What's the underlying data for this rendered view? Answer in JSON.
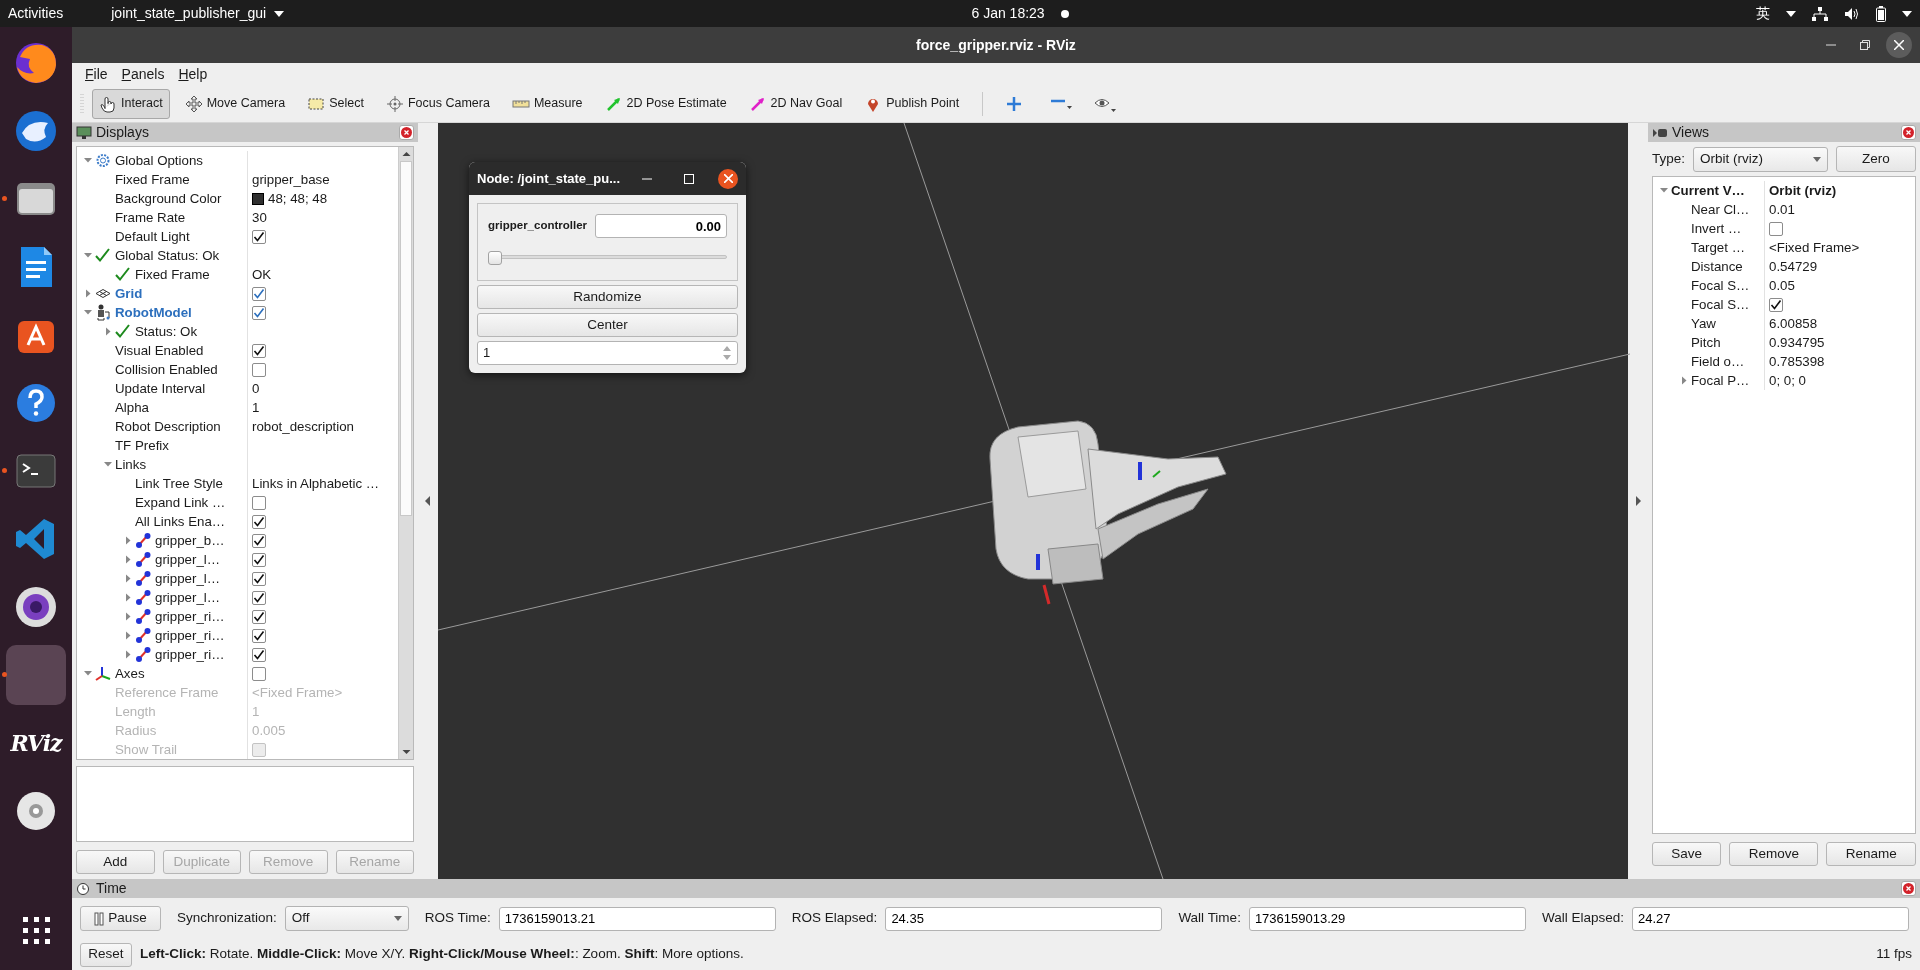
{
  "top_bar": {
    "activities": "Activities",
    "app_menu": "joint_state_publisher_gui",
    "clock": "6 Jan 18:23",
    "input_method": "英"
  },
  "dock": [
    {
      "kind": "browser",
      "running": false,
      "selected": false
    },
    {
      "kind": "mail",
      "running": false,
      "selected": false
    },
    {
      "kind": "files",
      "running": true,
      "selected": false
    },
    {
      "kind": "writer",
      "running": false,
      "selected": false
    },
    {
      "kind": "store",
      "running": false,
      "selected": false
    },
    {
      "kind": "help",
      "running": false,
      "selected": false
    },
    {
      "kind": "terminal",
      "running": true,
      "selected": false
    },
    {
      "kind": "editor",
      "running": false,
      "selected": false
    },
    {
      "kind": "camera",
      "running": false,
      "selected": false
    },
    {
      "kind": "blank",
      "running": true,
      "selected": true
    },
    {
      "kind": "logo",
      "label": "RViz",
      "running": false,
      "selected": false
    },
    {
      "kind": "disc",
      "running": false,
      "selected": false
    }
  ],
  "window": {
    "title": "force_gripper.rviz - RViz"
  },
  "menu": [
    "File",
    "Panels",
    "Help"
  ],
  "toolbar": [
    {
      "kind": "interact",
      "label": "Interact",
      "selected": true
    },
    {
      "kind": "move",
      "label": "Move Camera",
      "selected": false
    },
    {
      "kind": "select",
      "label": "Select",
      "selected": false
    },
    {
      "kind": "focus",
      "label": "Focus Camera",
      "selected": false
    },
    {
      "kind": "measure",
      "label": "Measure",
      "selected": false
    },
    {
      "kind": "pose",
      "label": "2D Pose Estimate",
      "selected": false
    },
    {
      "kind": "goal",
      "label": "2D Nav Goal",
      "selected": false
    },
    {
      "kind": "point",
      "label": "Publish Point",
      "selected": false
    }
  ],
  "displays": {
    "title": "Displays",
    "tree": [
      {
        "label": "Global Options",
        "kind": "options",
        "expanded": true,
        "children": [
          {
            "label": "Fixed Frame",
            "value": "gripper_base"
          },
          {
            "label": "Background Color",
            "value": "48; 48; 48",
            "color": "#303030"
          },
          {
            "label": "Frame Rate",
            "value": "30"
          },
          {
            "label": "Default Light",
            "checked": true
          }
        ]
      },
      {
        "label": "Global Status: Ok",
        "kind": "status",
        "expanded": true,
        "children": [
          {
            "label": "Fixed Frame",
            "kind": "status",
            "value": "OK"
          }
        ]
      },
      {
        "label": "Grid",
        "kind": "grid",
        "checked": true,
        "expanded": false
      },
      {
        "label": "RobotModel",
        "kind": "robot",
        "checked": true,
        "expanded": true,
        "children": [
          {
            "label": "Status: Ok",
            "kind": "status",
            "expanded": false
          },
          {
            "label": "Visual Enabled",
            "checked": true
          },
          {
            "label": "Collision Enabled",
            "checked": false
          },
          {
            "label": "Update Interval",
            "value": "0"
          },
          {
            "label": "Alpha",
            "value": "1"
          },
          {
            "label": "Robot Description",
            "value": "robot_description"
          },
          {
            "label": "TF Prefix"
          },
          {
            "label": "Links",
            "expanded": true,
            "children": [
              {
                "label": "Link Tree Style",
                "value": "Links in Alphabetic …"
              },
              {
                "label": "Expand Link …",
                "checked": false
              },
              {
                "label": "All Links Ena…",
                "checked": true
              },
              {
                "label": "gripper_b…",
                "kind": "link",
                "checked": true,
                "expanded": false
              },
              {
                "label": "gripper_l…",
                "kind": "link",
                "checked": true,
                "expanded": false
              },
              {
                "label": "gripper_l…",
                "kind": "link",
                "checked": true,
                "expanded": false
              },
              {
                "label": "gripper_l…",
                "kind": "link",
                "checked": true,
                "expanded": false
              },
              {
                "label": "gripper_ri…",
                "kind": "link",
                "checked": true,
                "expanded": false
              },
              {
                "label": "gripper_ri…",
                "kind": "link",
                "checked": true,
                "expanded": false
              },
              {
                "label": "gripper_ri…",
                "kind": "link",
                "checked": true,
                "expanded": false
              }
            ]
          }
        ]
      },
      {
        "label": "Axes",
        "kind": "axes",
        "checked": false,
        "expanded": true,
        "children": [
          {
            "label": "Reference Frame",
            "value": "<Fixed Frame>",
            "disabled": true
          },
          {
            "label": "Length",
            "value": "1",
            "disabled": true
          },
          {
            "label": "Radius",
            "value": "0.005",
            "disabled": true
          },
          {
            "label": "Show Trail",
            "checked": false,
            "disabled": true
          }
        ]
      }
    ],
    "buttons": [
      {
        "label": "Add",
        "disabled": false
      },
      {
        "label": "Duplicate",
        "disabled": true
      },
      {
        "label": "Remove",
        "disabled": true
      },
      {
        "label": "Rename",
        "disabled": true
      }
    ]
  },
  "node_dialog": {
    "title": "Node: /joint_state_pu...",
    "joints": [
      {
        "name": "gripper_controller",
        "value": "0.00",
        "level": 0
      }
    ],
    "buttons": [
      "Randomize",
      "Center"
    ],
    "spin_value": "1"
  },
  "views": {
    "title": "Views",
    "type_label": "Type:",
    "type_value": "Orbit (rviz)",
    "zero": "Zero",
    "tree": [
      {
        "label": "Current V…",
        "value": "Orbit (rviz)",
        "expanded": true,
        "children": [
          {
            "label": "Near Cl…",
            "value": "0.01"
          },
          {
            "label": "Invert …",
            "checked": false
          },
          {
            "label": "Target …",
            "value": "<Fixed Frame>"
          },
          {
            "label": "Distance",
            "value": "0.54729"
          },
          {
            "label": "Focal S…",
            "value": "0.05"
          },
          {
            "label": "Focal S…",
            "checked": true
          },
          {
            "label": "Yaw",
            "value": "6.00858"
          },
          {
            "label": "Pitch",
            "value": "0.934795"
          },
          {
            "label": "Field o…",
            "value": "0.785398"
          },
          {
            "label": "Focal P…",
            "value": "0; 0; 0",
            "expanded": false
          }
        ]
      }
    ],
    "buttons": [
      "Save",
      "Remove",
      "Rename"
    ]
  },
  "time": {
    "title": "Time",
    "pause": "Pause",
    "sync_label": "Synchronization:",
    "sync_value": "Off",
    "fields": [
      {
        "label": "ROS Time:",
        "value": "1736159013.21"
      },
      {
        "label": "ROS Elapsed:",
        "value": "24.35"
      },
      {
        "label": "Wall Time:",
        "value": "1736159013.29"
      },
      {
        "label": "Wall Elapsed:",
        "value": "24.27"
      }
    ]
  },
  "status_bar": {
    "reset": "Reset",
    "hint": "**Left-Click:** Rotate. **Middle-Click:** Move X/Y. **Right-Click/Mouse Wheel:**: Zoom. **Shift**: More options.",
    "fps": "11 fps"
  }
}
